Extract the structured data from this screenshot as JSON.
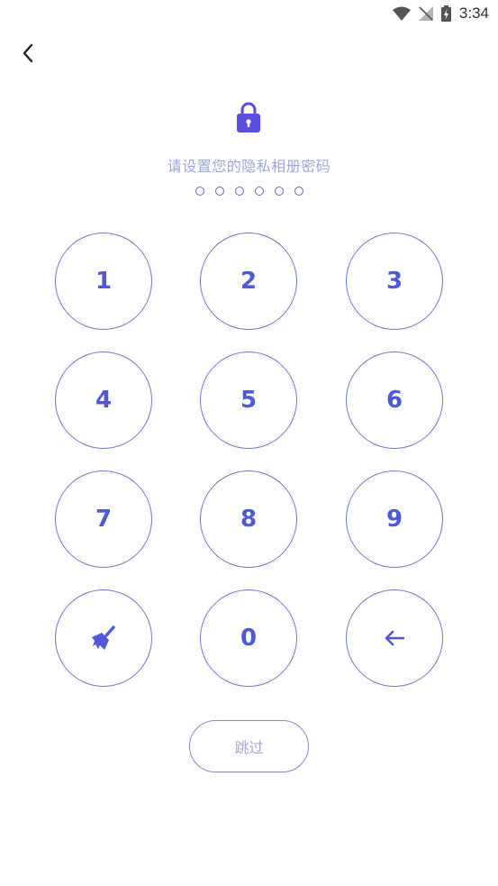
{
  "status_bar": {
    "time": "3:34"
  },
  "prompt": "请设置您的隐私相册密码",
  "pin_length": 6,
  "keypad": {
    "k1": "1",
    "k2": "2",
    "k3": "3",
    "k4": "4",
    "k5": "5",
    "k6": "6",
    "k7": "7",
    "k8": "8",
    "k9": "9",
    "k0": "0",
    "clear_icon": "broom-icon",
    "delete_icon": "arrow-left-icon"
  },
  "skip_label": "跳过",
  "colors": {
    "accent": "#4f5ad8",
    "prompt": "#9aa8de",
    "ring": "#7079d8",
    "lock": "#5a4ee0"
  }
}
